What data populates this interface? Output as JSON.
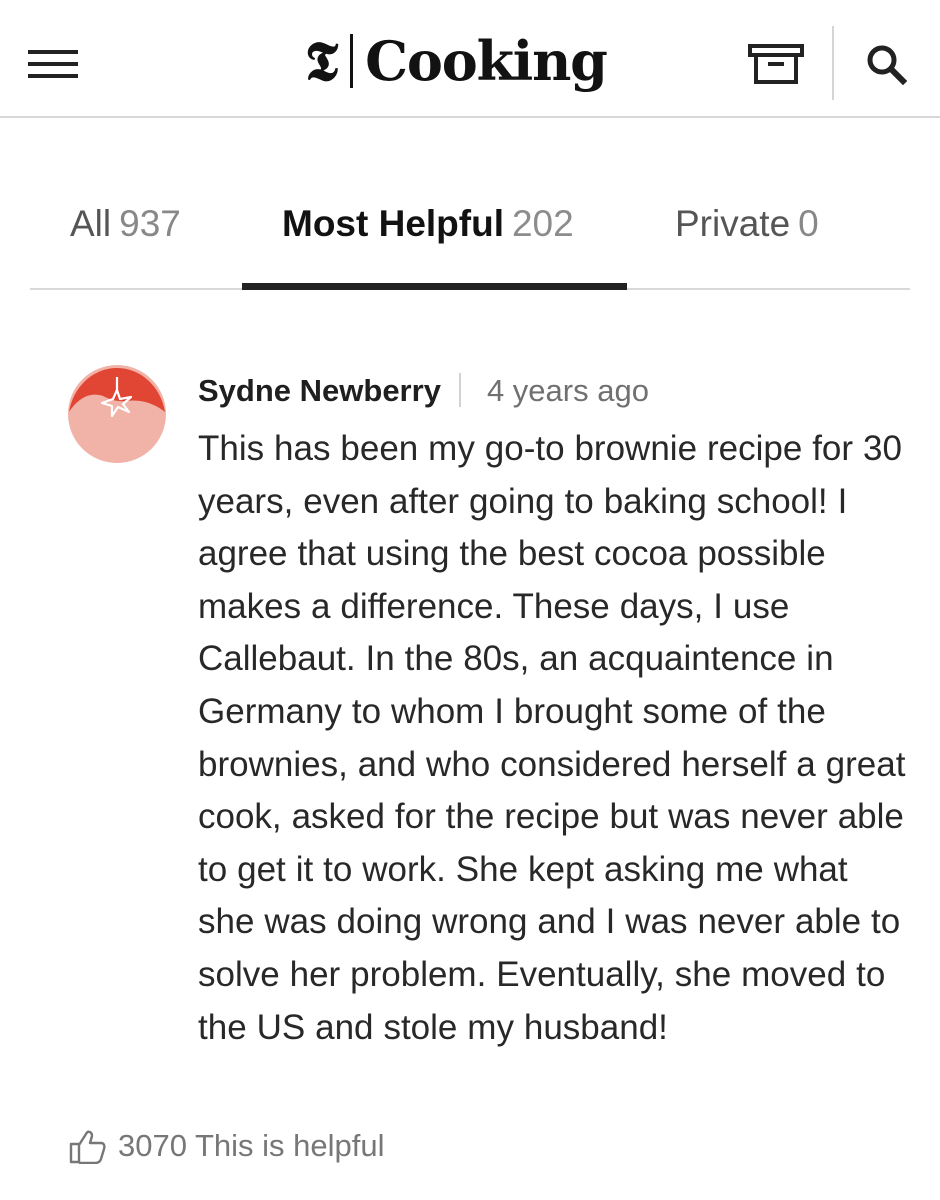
{
  "header": {
    "menu_icon": "hamburger-menu-icon",
    "brand_mark": "𝕿",
    "brand_name": "Cooking",
    "recipe_box_icon": "recipe-box-icon",
    "search_icon": "search-icon"
  },
  "tabs": [
    {
      "label": "All",
      "count": "937"
    },
    {
      "label": "Most Helpful",
      "count": "202"
    },
    {
      "label": "Private",
      "count": "0"
    }
  ],
  "comment": {
    "avatar_icon": "tomato-avatar-icon",
    "author": "Sydne Newberry",
    "time": "4 years ago",
    "text": "This has been my go-to brownie recipe for 30 years, even after going to baking school! I agree that using the best cocoa possible makes a difference. These days, I use Callebaut. In the 80s, an acquaintence in Germany to whom I brought some of the brownies, and who considered herself a great cook, asked for the recipe but was never able to get it to work. She kept asking me what she was doing wrong and I was never able to solve her problem. Eventually, she moved to the US and stole my husband!",
    "helpful_icon": "thumbs-up-icon",
    "helpful_count": "3070",
    "helpful_label": "This is helpful"
  },
  "colors": {
    "text": "#1f1f1f",
    "muted": "#707070",
    "divider": "#d7d7d7",
    "avatar_red": "#e14533",
    "avatar_pink": "#f1b2a8"
  }
}
